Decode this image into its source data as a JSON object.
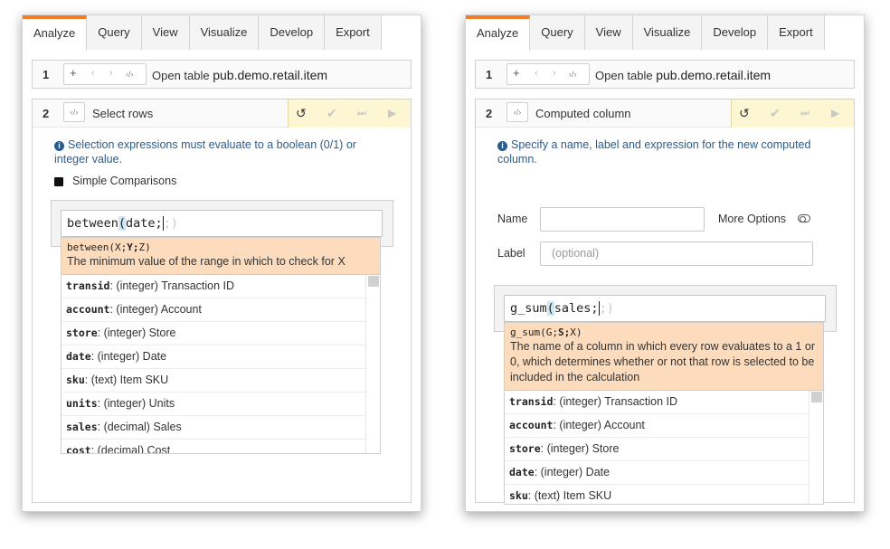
{
  "tabs": [
    "Analyze",
    "Query",
    "View",
    "Visualize",
    "Develop",
    "Export"
  ],
  "accent_color": "#f37b2a",
  "step1": {
    "number": "1",
    "tool_icons": [
      "plus-icon",
      "left-arrow-icon",
      "right-arrow-icon",
      "code-icon"
    ],
    "tool_glyphs": {
      "plus": "+",
      "left": "‹",
      "right": "›",
      "code": "‹/›"
    },
    "text": "Open table",
    "table": "pub.demo.retail.item"
  },
  "action_icons": [
    "undo-icon",
    "check-icon",
    "step-end-icon",
    "play-icon"
  ],
  "action_glyphs": {
    "undo": "↺",
    "check": "✔",
    "step": "⏭",
    "play": "▶"
  },
  "left": {
    "step2": {
      "number": "2",
      "code_glyph": "‹/›",
      "title": "Select rows",
      "info": "Selection expressions must evaluate to a boolean (0/1) or integer value.",
      "checkbox_label": "Simple Comparisons",
      "expression": {
        "prefix": "between",
        "paren": "(",
        "typed": "date;",
        "ghost": ";)"
      },
      "hint": {
        "sig_name": "between(",
        "sig_x": "X;",
        "sig_y": "Y;",
        "sig_z": "Z)",
        "text": "The minimum value of the range in which to check for X"
      },
      "items": [
        {
          "field": "transid",
          "desc": ": (integer) Transaction ID"
        },
        {
          "field": "account",
          "desc": ": (integer) Account"
        },
        {
          "field": "store",
          "desc": ": (integer) Store"
        },
        {
          "field": "date",
          "desc": ": (integer) Date"
        },
        {
          "field": "sku",
          "desc": ": (text) Item SKU"
        },
        {
          "field": "units",
          "desc": ": (integer) Units"
        },
        {
          "field": "sales",
          "desc": ": (decimal) Sales"
        },
        {
          "field": "cost",
          "desc": ": (decimal) Cost"
        }
      ]
    }
  },
  "right": {
    "step2": {
      "number": "2",
      "code_glyph": "‹/›",
      "title": "Computed column",
      "info": "Specify a name, label and expression for the new computed column.",
      "name_label": "Name",
      "name_value": "",
      "more_options_label": "More Options",
      "label_label": "Label",
      "label_placeholder": "(optional)",
      "expression": {
        "prefix": "g_sum",
        "paren": "(",
        "typed": "sales;",
        "ghost": ";)"
      },
      "hint": {
        "sig_name": "g_sum(",
        "sig_g": "G;",
        "sig_s": "S;",
        "sig_x": "X)",
        "text": "The name of a column in which every row evaluates to a 1 or 0, which determines whether or not that row is selected to be included in the calculation"
      },
      "items": [
        {
          "field": "transid",
          "desc": ": (integer) Transaction ID"
        },
        {
          "field": "account",
          "desc": ": (integer) Account"
        },
        {
          "field": "store",
          "desc": ": (integer) Store"
        },
        {
          "field": "date",
          "desc": ": (integer) Date"
        },
        {
          "field": "sku",
          "desc": ": (text) Item SKU"
        }
      ]
    }
  }
}
